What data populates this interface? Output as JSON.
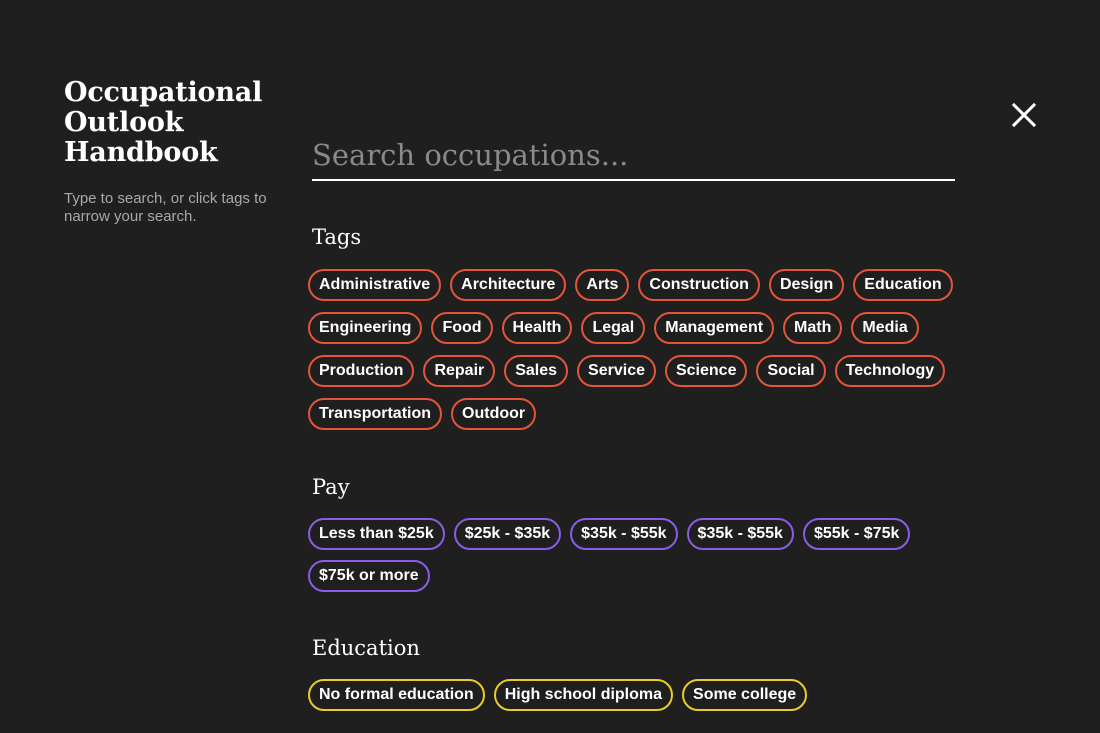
{
  "sidebar": {
    "title": "Occupational Outlook Handbook",
    "subtitle": "Type to search, or click tags to narrow your search."
  },
  "search": {
    "placeholder": "Search occupations...",
    "value": ""
  },
  "close": {
    "icon": "close-icon"
  },
  "sections": {
    "tags": {
      "title": "Tags",
      "color": "#e4553a",
      "items": [
        "Administrative",
        "Architecture",
        "Arts",
        "Construction",
        "Design",
        "Education",
        "Engineering",
        "Food",
        "Health",
        "Legal",
        "Management",
        "Math",
        "Media",
        "Production",
        "Repair",
        "Sales",
        "Service",
        "Science",
        "Social",
        "Technology",
        "Transportation",
        "Outdoor"
      ]
    },
    "pay": {
      "title": "Pay",
      "color": "#8c5ce6",
      "items": [
        "Less than $25k",
        "$25k - $35k",
        "$35k - $55k",
        "$35k - $55k",
        "$55k - $75k",
        "$75k or more"
      ]
    },
    "education": {
      "title": "Education",
      "color": "#e8cc2a",
      "items": [
        "No formal education",
        "High school diploma",
        "Some college"
      ]
    }
  }
}
